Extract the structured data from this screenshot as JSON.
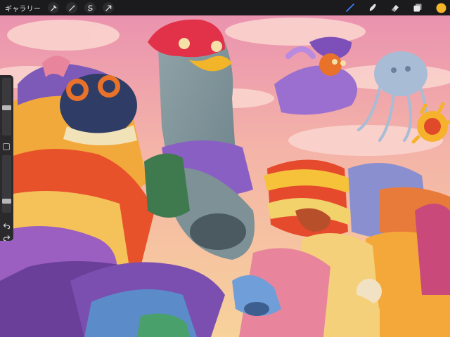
{
  "toolbar": {
    "gallery_label": "ギャラリー",
    "left_tools": [
      "wrench-icon",
      "magic-wand-icon",
      "selection-icon",
      "transform-arrow-icon"
    ],
    "right_tools": [
      "brush-icon",
      "smudge-icon",
      "eraser-icon",
      "layers-icon",
      "color-swatch"
    ],
    "active_tool": "brush",
    "active_color": "#f5b52b",
    "accent_color": "#3f82ff"
  },
  "sidebar": {
    "brush_size_level": 0.48,
    "opacity_level": 0.18,
    "controls": [
      "brush-size-slider",
      "modify-button",
      "opacity-slider",
      "undo-icon",
      "redo-icon"
    ]
  },
  "canvas": {
    "content": "illustration-artwork"
  }
}
